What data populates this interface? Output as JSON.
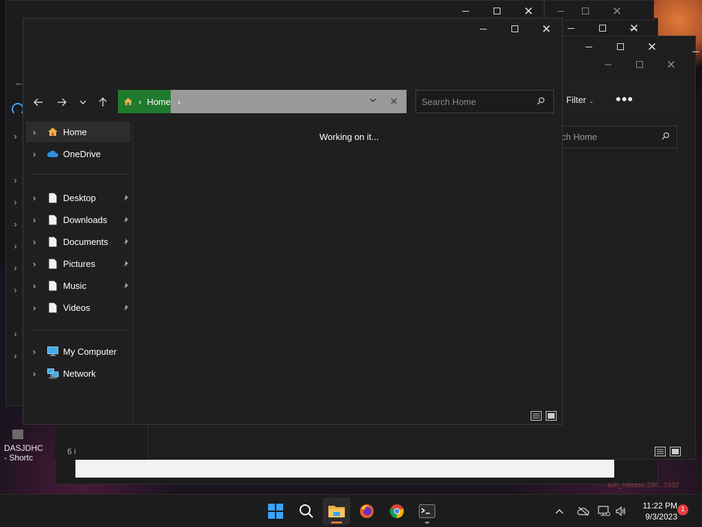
{
  "background_windows": {
    "bg4_toolbar": {
      "filter_label": "Filter",
      "filter_caret": "⌄",
      "more_label": "•••"
    },
    "bg4_search": {
      "placeholder_visible": "ch Home"
    },
    "desktop_icon": {
      "label_line1": "DASJDHC",
      "label_line2": "- Shortc"
    },
    "dark_strip_text": "6 i",
    "desktop_text_right": "ash_release.230...1632"
  },
  "window": {
    "caption": {
      "minimize": "minimize-button",
      "maximize": "maximize-button",
      "close": "close-button"
    },
    "address_bar": {
      "crumb": "Home",
      "separator": "›"
    },
    "search": {
      "placeholder": "Search Home"
    },
    "status_message": "Working on it...",
    "nav_pane": {
      "items": [
        {
          "label": "Home",
          "icon": "home-icon",
          "selected": true
        },
        {
          "label": "OneDrive",
          "icon": "cloud-icon"
        },
        {
          "label": "Desktop",
          "icon": "file-icon",
          "pinned": true
        },
        {
          "label": "Downloads",
          "icon": "file-icon",
          "pinned": true
        },
        {
          "label": "Documents",
          "icon": "file-icon",
          "pinned": true
        },
        {
          "label": "Pictures",
          "icon": "file-icon",
          "pinned": true
        },
        {
          "label": "Music",
          "icon": "file-icon",
          "pinned": true
        },
        {
          "label": "Videos",
          "icon": "file-icon",
          "pinned": true
        },
        {
          "label": "My Computer",
          "icon": "computer-icon"
        },
        {
          "label": "Network",
          "icon": "network-icon"
        }
      ]
    }
  },
  "taskbar": {
    "apps": [
      "start-icon",
      "search-icon",
      "file-explorer-icon",
      "firefox-icon",
      "chrome-icon",
      "terminal-icon"
    ],
    "clock": {
      "time": "11:22 PM",
      "date": "9/3/2023"
    },
    "notification_count": "1"
  },
  "colors": {
    "address_green": "#1f7a2e",
    "address_gray": "#9a9a9a",
    "window_bg": "#1f1f1f",
    "accent_blue": "#3aa3ff"
  }
}
